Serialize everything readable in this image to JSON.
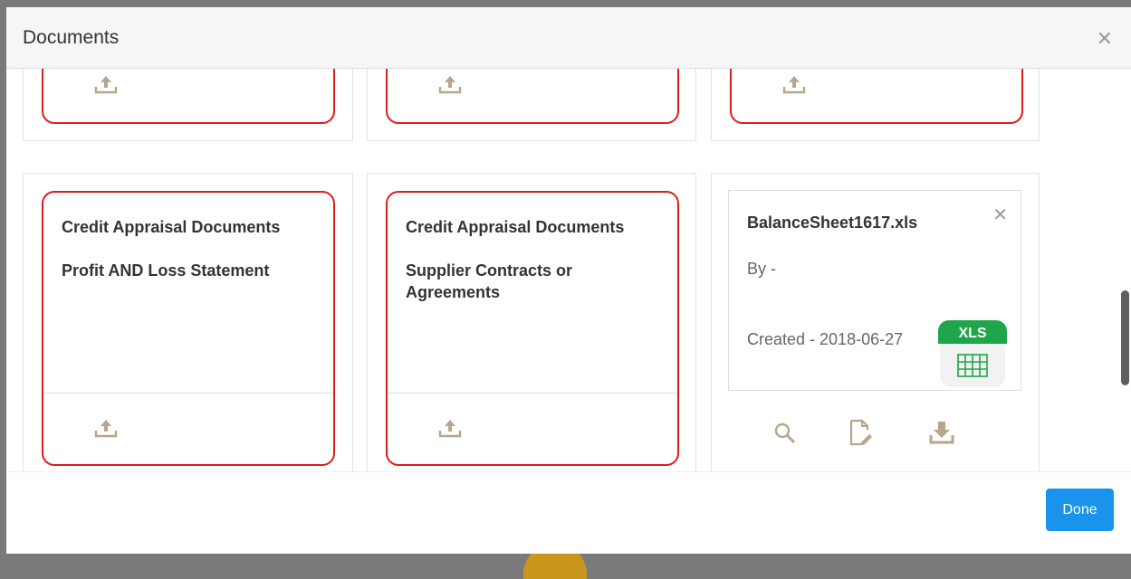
{
  "modal": {
    "title": "Documents",
    "close_icon": "close-icon"
  },
  "cards": [
    {
      "category": "Credit Appraisal Documents",
      "name": "Profit AND Loss Statement"
    },
    {
      "category": "Credit Appraisal Documents",
      "name": "Supplier Contracts or Agreements"
    }
  ],
  "file": {
    "name": "BalanceSheet1617.xls",
    "by": "By -",
    "created": "Created - 2018-06-27",
    "badge": "XLS",
    "badge_color": "#1fa64a"
  },
  "actions": [
    "search-icon",
    "edit-document-icon",
    "download-icon"
  ],
  "footer": {
    "done_label": "Done"
  },
  "colors": {
    "accent": "#1a93ec",
    "required_border": "#e01b1b",
    "icon": "#b7a58c"
  }
}
